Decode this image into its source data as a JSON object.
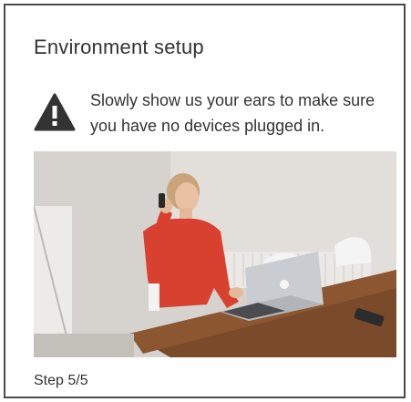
{
  "card": {
    "title": "Environment setup",
    "warning": {
      "icon": "warning-triangle-icon",
      "message": "Slowly show us your ears to make sure you have no devices plugged in."
    },
    "video": {
      "description_icon": "webcam-preview"
    },
    "step_label": "Step 5/5"
  },
  "colors": {
    "border": "#4a4a4a",
    "text": "#333333",
    "warning_icon": "#333333"
  }
}
